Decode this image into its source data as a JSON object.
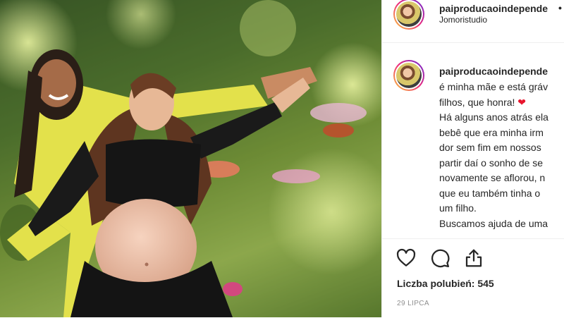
{
  "post": {
    "image_alt": "",
    "header": {
      "username": "paiproducaoindepende",
      "separator": "•",
      "location": "Jomoristudio"
    },
    "caption": {
      "username": "paiproducaoindepende",
      "lines": [
        "é minha mãe e está gráv",
        "filhos, que honra! ❤",
        "Há alguns anos atrás ela",
        "bebê que era minha irm",
        "dor sem fim em nossos",
        "partir daí o sonho de se",
        "novamente se aflorou, n",
        "que eu também tinha o",
        "um filho.",
        "Buscamos ajuda de uma"
      ]
    },
    "actions": {
      "like_icon": "heart-outline-icon",
      "comment_icon": "comment-bubble-icon",
      "share_icon": "share-icon"
    },
    "likes_text": "Liczba polubień: 545",
    "date": "29 LIPCA"
  }
}
